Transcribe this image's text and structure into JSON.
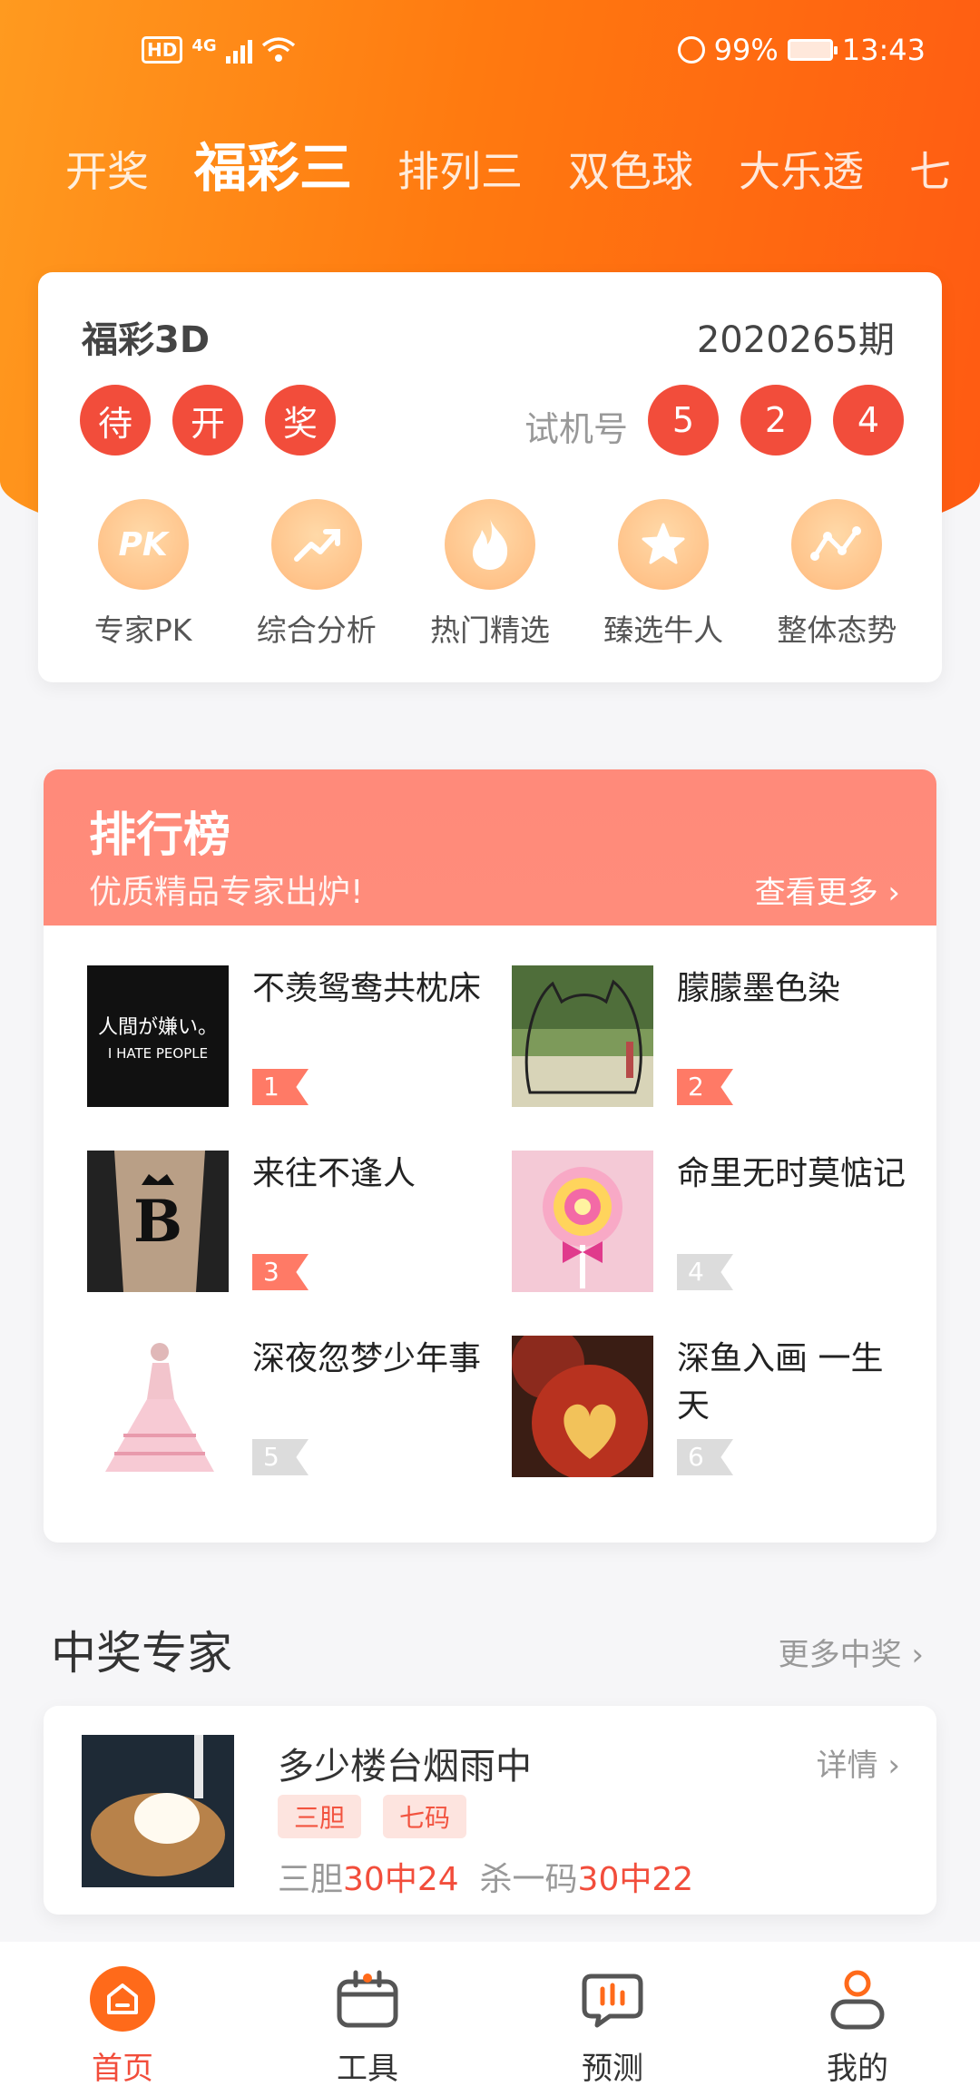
{
  "status_bar": {
    "hd": "HD",
    "net": "4G",
    "battery": "99%",
    "time": "13:43"
  },
  "tabs": [
    "开奖",
    "福彩三",
    "排列三",
    "双色球",
    "大乐透",
    "七"
  ],
  "lottery": {
    "name": "福彩3D",
    "issue": "2020265期",
    "status_balls": [
      "待",
      "开",
      "奖"
    ],
    "trial_label": "试机号",
    "trial_numbers": [
      "5",
      "2",
      "4"
    ]
  },
  "features": [
    {
      "label": "专家PK",
      "icon": "pk-icon",
      "glyph": "PK"
    },
    {
      "label": "综合分析",
      "icon": "trend-up-icon"
    },
    {
      "label": "热门精选",
      "icon": "flame-icon"
    },
    {
      "label": "臻选牛人",
      "icon": "star-icon"
    },
    {
      "label": "整体态势",
      "icon": "wave-chart-icon"
    }
  ],
  "ranking": {
    "title": "排行榜",
    "subtitle": "优质精品专家出炉!",
    "more": "查看更多",
    "items": [
      {
        "name": "不羡鸳鸯共枕床",
        "rank": "1",
        "avatar_text": "人間が嫌い。",
        "avatar_sub": "I HATE PEOPLE"
      },
      {
        "name": "朦朦墨色染",
        "rank": "2"
      },
      {
        "name": "来往不逢人",
        "rank": "3"
      },
      {
        "name": "命里无时莫惦记",
        "rank": "4"
      },
      {
        "name": "深夜忽梦少年事",
        "rank": "5"
      },
      {
        "name": "深鱼入画 一生天",
        "rank": "6"
      }
    ]
  },
  "winners": {
    "title": "中奖专家",
    "more": "更多中奖",
    "card": {
      "name": "多少楼台烟雨中",
      "detail": "详情",
      "tags": [
        "三胆",
        "七码"
      ],
      "stat1_label": "三胆",
      "stat1_value": "30中24",
      "stat2_label": "杀一码",
      "stat2_value": "30中22"
    }
  },
  "bottom_nav": [
    {
      "label": "首页",
      "icon": "home-icon"
    },
    {
      "label": "工具",
      "icon": "toolbox-icon"
    },
    {
      "label": "预测",
      "icon": "chat-bars-icon"
    },
    {
      "label": "我的",
      "icon": "user-icon"
    }
  ],
  "colors": {
    "brand_orange": "#ff7a10",
    "ball_red": "#f24d3b",
    "rank_header": "#ff8a7a"
  }
}
